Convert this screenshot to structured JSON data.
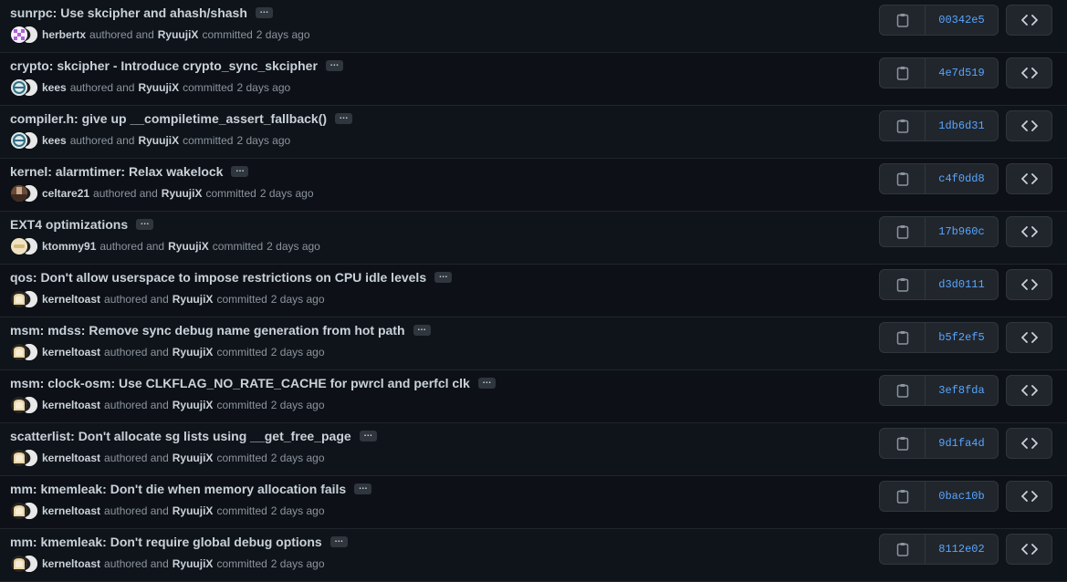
{
  "commits": [
    {
      "title": "sunrpc: Use skcipher and ahash/shash",
      "author": "herbertx",
      "authored_text": "authored and",
      "committer": "RyuujiX",
      "committed_text": "committed",
      "time": "2 days ago",
      "sha": "00342e5",
      "avatar": "purple-checker"
    },
    {
      "title": "crypto: skcipher - Introduce crypto_sync_skcipher",
      "author": "kees",
      "authored_text": "authored and",
      "committer": "RyuujiX",
      "committed_text": "committed",
      "time": "2 days ago",
      "sha": "4e7d519",
      "avatar": "blue-ring"
    },
    {
      "title": "compiler.h: give up __compiletime_assert_fallback()",
      "author": "kees",
      "authored_text": "authored and",
      "committer": "RyuujiX",
      "committed_text": "committed",
      "time": "2 days ago",
      "sha": "1db6d31",
      "avatar": "blue-ring"
    },
    {
      "title": "kernel: alarmtimer: Relax wakelock",
      "author": "celtare21",
      "authored_text": "authored and",
      "committer": "RyuujiX",
      "committed_text": "committed",
      "time": "2 days ago",
      "sha": "c4f0dd8",
      "avatar": "photo-brown"
    },
    {
      "title": "EXT4 optimizations",
      "author": "ktommy91",
      "authored_text": "authored and",
      "committer": "RyuujiX",
      "committed_text": "committed",
      "time": "2 days ago",
      "sha": "17b960c",
      "avatar": "beige-emoji"
    },
    {
      "title": "qos: Don't allow userspace to impose restrictions on CPU idle levels",
      "author": "kerneltoast",
      "authored_text": "authored and",
      "committer": "RyuujiX",
      "committed_text": "committed",
      "time": "2 days ago",
      "sha": "d3d0111",
      "avatar": "toast"
    },
    {
      "title": "msm: mdss: Remove sync debug name generation from hot path",
      "author": "kerneltoast",
      "authored_text": "authored and",
      "committer": "RyuujiX",
      "committed_text": "committed",
      "time": "2 days ago",
      "sha": "b5f2ef5",
      "avatar": "toast"
    },
    {
      "title": "msm: clock-osm: Use CLKFLAG_NO_RATE_CACHE for pwrcl and perfcl clk",
      "author": "kerneltoast",
      "authored_text": "authored and",
      "committer": "RyuujiX",
      "committed_text": "committed",
      "time": "2 days ago",
      "sha": "3ef8fda",
      "avatar": "toast"
    },
    {
      "title": "scatterlist: Don't allocate sg lists using __get_free_page",
      "author": "kerneltoast",
      "authored_text": "authored and",
      "committer": "RyuujiX",
      "committed_text": "committed",
      "time": "2 days ago",
      "sha": "9d1fa4d",
      "avatar": "toast"
    },
    {
      "title": "mm: kmemleak: Don't die when memory allocation fails",
      "author": "kerneltoast",
      "authored_text": "authored and",
      "committer": "RyuujiX",
      "committed_text": "committed",
      "time": "2 days ago",
      "sha": "0bac10b",
      "avatar": "toast"
    },
    {
      "title": "mm: kmemleak: Don't require global debug options",
      "author": "kerneltoast",
      "authored_text": "authored and",
      "committer": "RyuujiX",
      "committed_text": "committed",
      "time": "2 days ago",
      "sha": "8112e02",
      "avatar": "toast"
    }
  ],
  "ellipsis_label": "…",
  "icons": {
    "copy": "clipboard-icon",
    "browse": "code-icon"
  },
  "colors": {
    "background": "#0d1117",
    "sha": "#58a6ff",
    "muted": "#8b949e",
    "text": "#c9d1d9"
  }
}
